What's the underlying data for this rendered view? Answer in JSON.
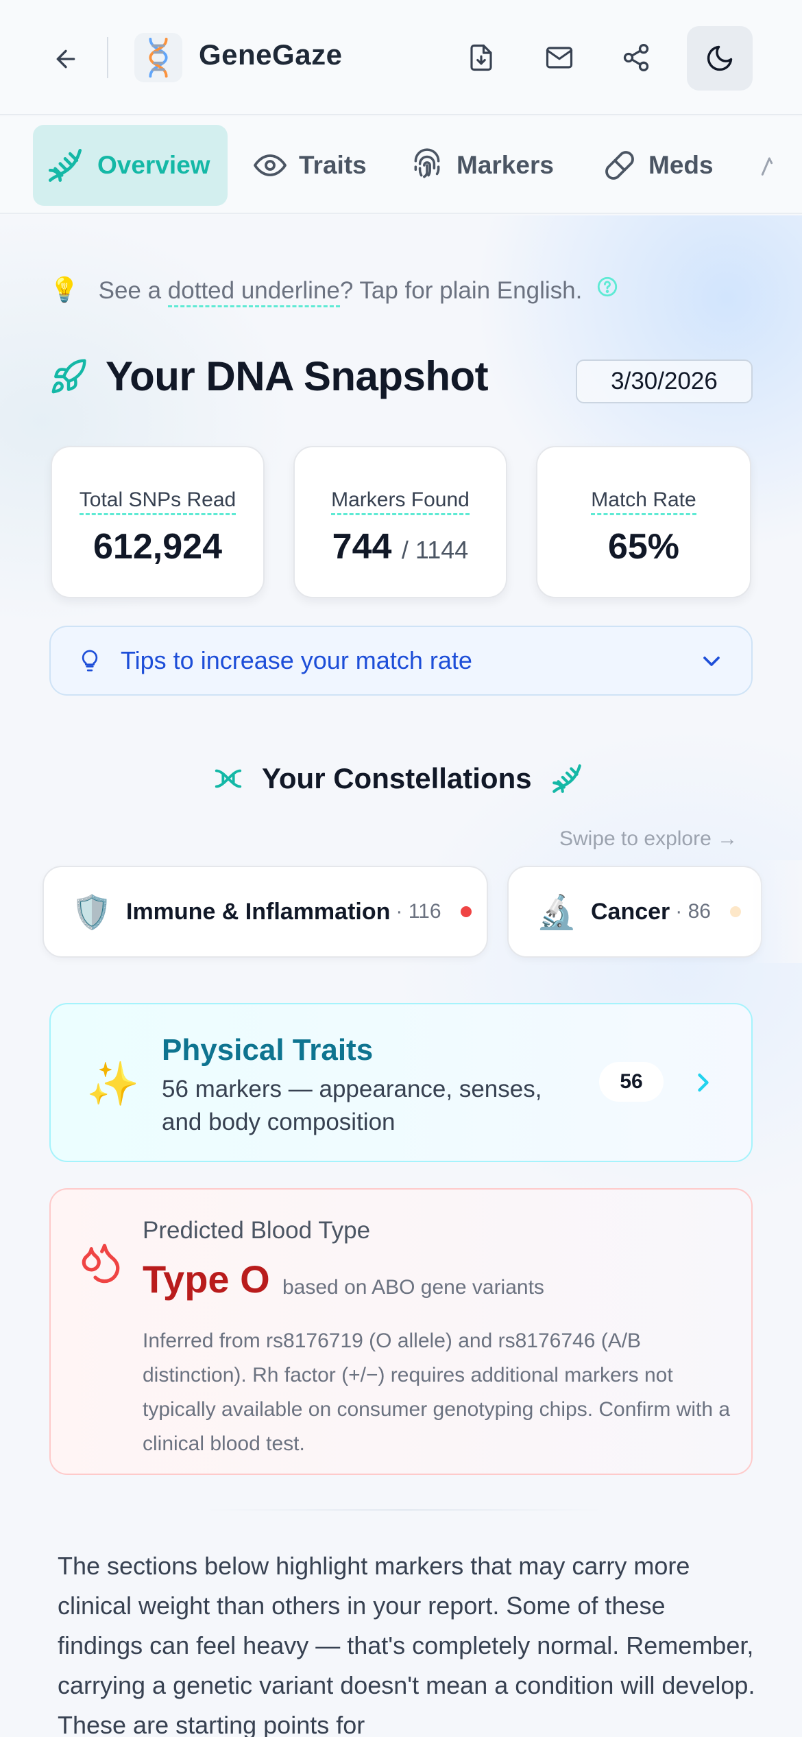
{
  "app": {
    "title": "GeneGaze"
  },
  "header": {
    "icons": [
      "arrow-left-icon",
      "download-file-icon",
      "mail-icon",
      "share-icon",
      "moon-icon"
    ]
  },
  "tabs": [
    {
      "label": "Overview",
      "icon": "dna-icon",
      "active": true
    },
    {
      "label": "Traits",
      "icon": "eye-icon",
      "active": false
    },
    {
      "label": "Markers",
      "icon": "fingerprint-icon",
      "active": false
    },
    {
      "label": "Meds",
      "icon": "pill-icon",
      "active": false
    }
  ],
  "hint": {
    "emoji": "💡",
    "prefix": "See a",
    "dotted": "dotted underline",
    "suffix": "? Tap for plain English."
  },
  "snapshot": {
    "title": "Your DNA Snapshot",
    "date": "3/30/2026",
    "stats": [
      {
        "label": "Total SNPs Read",
        "value": "612,924",
        "sub": ""
      },
      {
        "label": "Markers Found",
        "value": "744",
        "sub": "/ 1144"
      },
      {
        "label": "Match Rate",
        "value": "65%",
        "sub": ""
      }
    ],
    "tips_label": "Tips to increase your match rate"
  },
  "constellations": {
    "title": "Your Constellations",
    "swipe": "Swipe to explore →",
    "items": [
      {
        "emoji": "🛡️",
        "name": "Immune & Inflammation",
        "count": "· 116",
        "dot_color": "#ef4444"
      },
      {
        "emoji": "🔬",
        "name": "Cancer",
        "count": "· 86",
        "dot_color": "#fde7c8"
      }
    ]
  },
  "traits_card": {
    "emoji": "✨",
    "title": "Physical Traits",
    "desc": "56 markers — appearance, senses, and body composition",
    "badge": "56"
  },
  "blood": {
    "label": "Predicted Blood Type",
    "type": "Type O",
    "basis": "based on ABO gene variants",
    "note": "Inferred from rs8176719 (O allele) and rs8176746 (A/B distinction). Rh factor (+/−) requires additional markers not typically available on consumer genotyping chips. Confirm with a clinical blood test."
  },
  "intro": "The sections below highlight markers that may carry more clinical weight than others in your report. Some of these findings can feel heavy — that's completely normal. Remember, carrying a genetic variant doesn't mean a condition will develop. These are starting points for",
  "colors": {
    "accent": "#14b8a6",
    "link": "#1d4ed8",
    "danger": "#b91c1c",
    "traits": "#0e7490"
  }
}
